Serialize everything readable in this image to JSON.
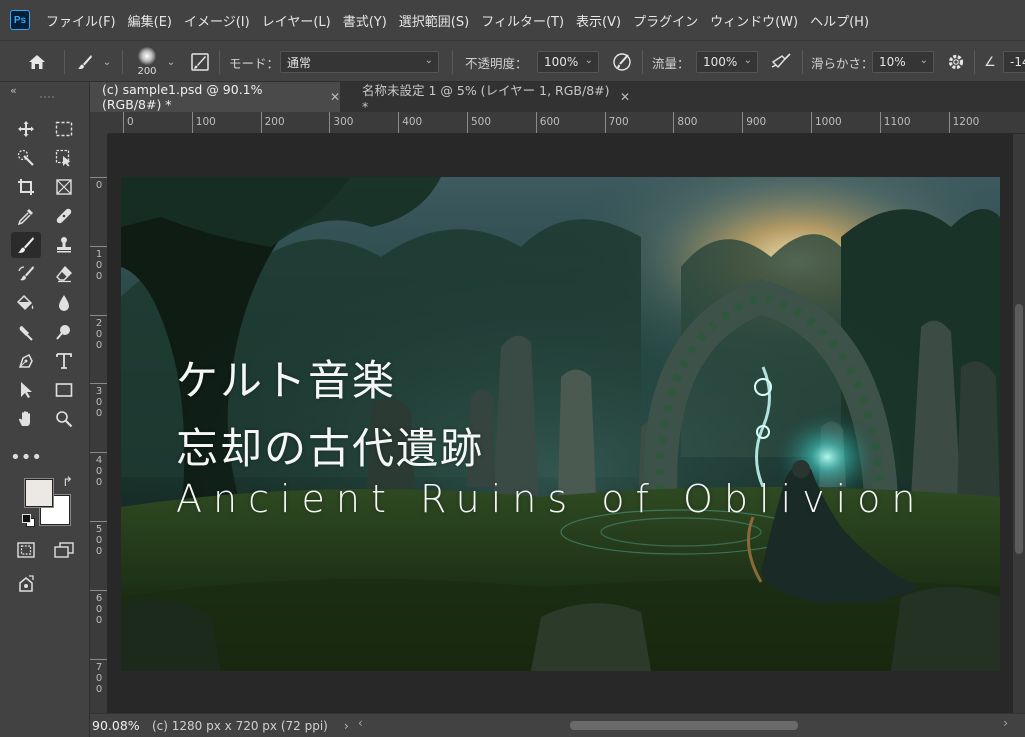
{
  "app": {
    "logo": "Ps"
  },
  "menu": [
    "ファイル(F)",
    "編集(E)",
    "イメージ(I)",
    "レイヤー(L)",
    "書式(Y)",
    "選択範囲(S)",
    "フィルター(T)",
    "表示(V)",
    "プラグイン",
    "ウィンドウ(W)",
    "ヘルプ(H)"
  ],
  "options": {
    "brush_size": "200",
    "mode_label": "モード：",
    "mode_value": "通常",
    "opacity_label": "不透明度：",
    "opacity_value": "100%",
    "flow_label": "流量：",
    "flow_value": "100%",
    "smoothing_label": "滑らかさ：",
    "smoothing_value": "10%",
    "angle_value": "-14"
  },
  "tabs": [
    {
      "label": "(c) sample1.psd @ 90.1% (RGB/8#) *",
      "active": true
    },
    {
      "label": "名称未設定 1 @ 5% (レイヤー 1, RGB/8#) *",
      "active": false
    }
  ],
  "ruler_top": [
    "0",
    "100",
    "200",
    "300",
    "400",
    "500",
    "600",
    "700",
    "800",
    "900",
    "1000",
    "1100",
    "1200"
  ],
  "ruler_left": [
    "0",
    "100",
    "200",
    "300",
    "400",
    "500",
    "600",
    "700"
  ],
  "canvas": {
    "line1": "ケルト音楽",
    "line2": "忘却の古代遺跡",
    "line3": "Ancient Ruins of Oblivion"
  },
  "colors": {
    "foreground": "#ece8e4",
    "background": "#ffffff"
  },
  "status": {
    "zoom": "90.08%",
    "doc_info": "(c) 1280 px x 720 px (72 ppi)"
  },
  "tools": [
    "move-tool",
    "marquee-tool",
    "quick-selection-tool",
    "object-selection-tool",
    "crop-tool",
    "frame-tool",
    "eyedropper-tool",
    "healing-brush-tool",
    "brush-tool",
    "clone-stamp-tool",
    "history-brush-tool",
    "eraser-tool",
    "paint-bucket-tool",
    "blur-tool",
    "dodge-tool",
    "smudge-tool",
    "pen-tool",
    "type-tool",
    "path-selection-tool",
    "rectangle-tool",
    "hand-tool",
    "zoom-tool",
    "more-tools"
  ]
}
